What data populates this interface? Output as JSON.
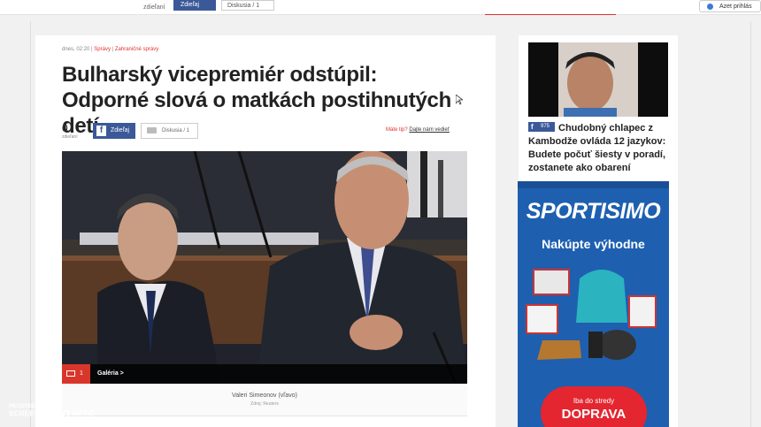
{
  "topbar": {
    "share_count_label": "zdieľaní",
    "fb_label": "Zdieľaj",
    "comments_label": "Diskusia / 1",
    "right_button_label": "Azet prihlás"
  },
  "article": {
    "time": "dnes, 02:20",
    "section": "Správy",
    "subsection": "Zahraničné správy",
    "title": "Bulharský vicepremiér odstúpil: Odporné slová o matkách postihnutých detí",
    "share_count": "0",
    "share_count_label": "zdieľaní",
    "fb_share_label": "Zdieľaj",
    "comment_label": "Diskusia / 1",
    "tip_question": "Máte tip?",
    "tip_link": "Dajte nám vedieť",
    "gallery_count": "1",
    "gallery_label": "Galéria >",
    "caption": "Valeri Simeonov (vľavo)",
    "caption_source": "Zdroj: Reuters"
  },
  "sidebar": {
    "fb_count": "975",
    "headline": "Chudobný chlapec z Kambodže ovláda 12 jazykov: Budete počuť šiesty v poradí, zostanete ako obarení",
    "ad": {
      "brand": "SPORTISIMO",
      "slogan": "Nakúpte výhodne",
      "badge_line1": "Iba do stredy",
      "badge_line2": "DOPRAVA"
    }
  },
  "watermark": {
    "line1": "RECORDED WITH",
    "line2_a": "SCREENCAST",
    "line2_b": "MATIC"
  }
}
